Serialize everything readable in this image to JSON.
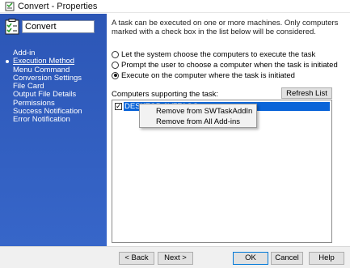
{
  "window": {
    "title": "Convert - Properties",
    "app_icon": "solidworks-task-icon"
  },
  "sidebar": {
    "task_icon": "task-clipboard-icon",
    "task_name_value": "Convert",
    "items": [
      {
        "label": "Add-in",
        "active": false
      },
      {
        "label": "Execution Method",
        "active": true
      },
      {
        "label": "Menu Command",
        "active": false
      },
      {
        "label": "Conversion Settings",
        "active": false
      },
      {
        "label": "File Card",
        "active": false
      },
      {
        "label": "Output File Details",
        "active": false
      },
      {
        "label": "Permissions",
        "active": false
      },
      {
        "label": "Success Notification",
        "active": false
      },
      {
        "label": "Error Notification",
        "active": false
      }
    ]
  },
  "main": {
    "description": "A task can be executed on one or more machines. Only computers marked with a check box in the list below will be considered.",
    "options": [
      {
        "label": "Let the system choose the computers to execute the task",
        "selected": false
      },
      {
        "label": "Prompt the user to choose a computer when the task is initiated",
        "selected": false
      },
      {
        "label": "Execute on the computer where the task is initiated",
        "selected": true
      }
    ],
    "computers_label": "Computers supporting the task:",
    "refresh_label": "Refresh List",
    "computers": [
      {
        "name": "DESKTOP-0V7FAGC",
        "checked": true
      }
    ]
  },
  "context_menu": {
    "items": [
      {
        "label": "Remove from SWTaskAddIn"
      },
      {
        "label": "Remove from All Add-ins"
      }
    ]
  },
  "footer": {
    "back_label": "< Back",
    "next_label": "Next >",
    "ok_label": "OK",
    "cancel_label": "Cancel",
    "help_label": "Help"
  },
  "colors": {
    "sidebar": "#2e5bbd",
    "selection": "#0a64d8",
    "default_button_border": "#0078d7"
  }
}
